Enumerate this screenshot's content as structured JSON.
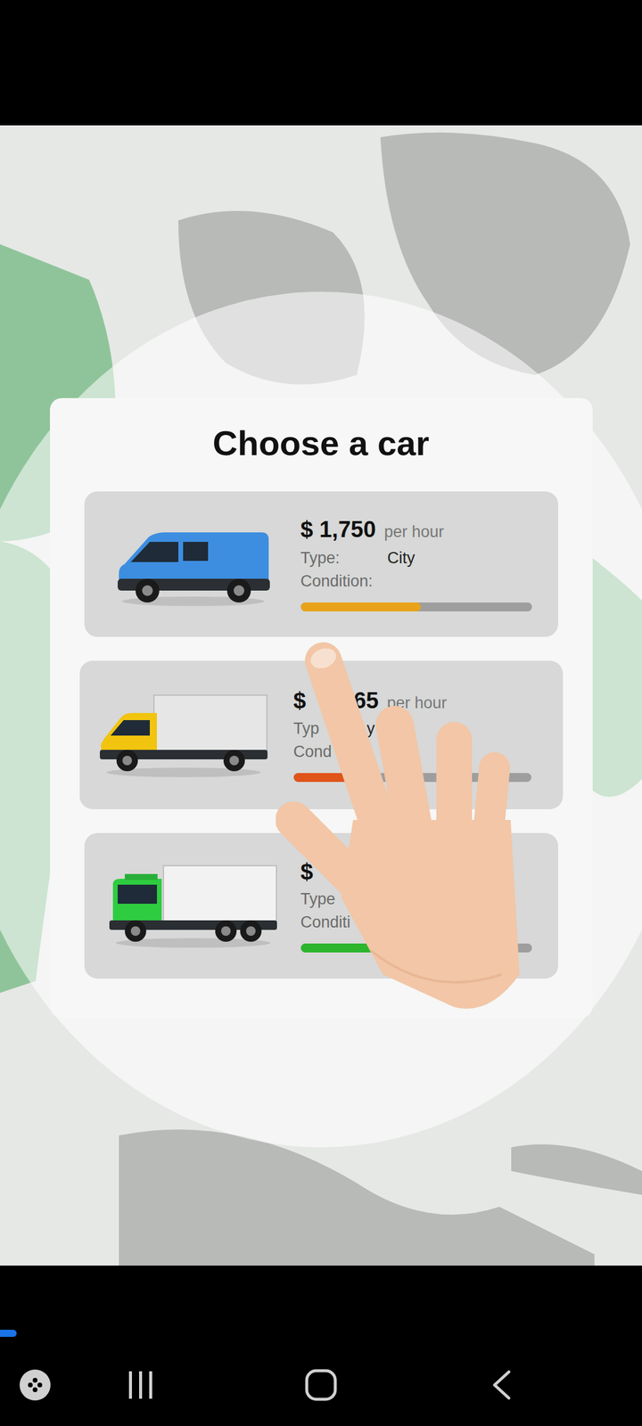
{
  "dialog": {
    "title": "Choose a car"
  },
  "cars": [
    {
      "vehicle": "van",
      "selected": false,
      "price_parts": [
        "$ 1,750"
      ],
      "unit": "per hour",
      "type_parts": [
        "Type:",
        "City"
      ],
      "condition": "Condition:",
      "level": 0.52,
      "color": "#e9a31a"
    },
    {
      "vehicle": "box-truck",
      "selected": true,
      "price_parts": [
        "$",
        "65"
      ],
      "unit": "per hour",
      "type_parts": [
        "Typ",
        "y"
      ],
      "condition": "Cond",
      "level": 0.35,
      "color": "#e0541a"
    },
    {
      "vehicle": "truck",
      "selected": false,
      "price_parts": [
        "$"
      ],
      "unit": "",
      "type_parts": [
        "Type"
      ],
      "condition": "Conditi",
      "level": 0.6,
      "color": "#2db52d"
    }
  ],
  "progress": {
    "level": 0.026
  }
}
